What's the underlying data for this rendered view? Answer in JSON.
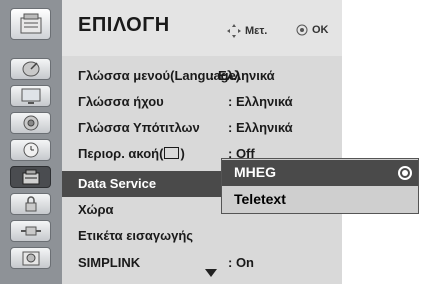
{
  "header": {
    "title": "ΕΠΙΛΟΓΗ",
    "hint_move": "Μετ.",
    "hint_ok": "OK",
    "title_icon": "option-menu-icon"
  },
  "sidebar": {
    "items": [
      {
        "icon": "satellite-dish-icon",
        "selected": false
      },
      {
        "icon": "tv-screen-icon",
        "selected": false
      },
      {
        "icon": "speaker-icon",
        "selected": false
      },
      {
        "icon": "clock-icon",
        "selected": false
      },
      {
        "icon": "option-menu-icon",
        "selected": true
      },
      {
        "icon": "lock-icon",
        "selected": false
      },
      {
        "icon": "input-connector-icon",
        "selected": false
      },
      {
        "icon": "dvd-disc-icon",
        "selected": false
      }
    ]
  },
  "menu": {
    "items": [
      {
        "label": "Γλώσσα μενού(Language)",
        "value": ": Ελληνικά"
      },
      {
        "label": "Γλώσσα ήχου",
        "value": ": Ελληνικά"
      },
      {
        "label": "Γλώσσα Υπότιτλων",
        "value": ": Ελληνικά"
      },
      {
        "label": "Περιορ. ακοή(",
        "value": ": Off"
      },
      {
        "label": "Data Service",
        "value": ""
      },
      {
        "label": "Χώρα",
        "value": ""
      },
      {
        "label": "Ετικέτα εισαγωγής",
        "value": ""
      },
      {
        "label": "SIMPLINK",
        "value": ": On"
      }
    ],
    "selected_index": 4
  },
  "popup": {
    "options": [
      "MHEG",
      "Teletext"
    ],
    "selected_index": 0
  }
}
